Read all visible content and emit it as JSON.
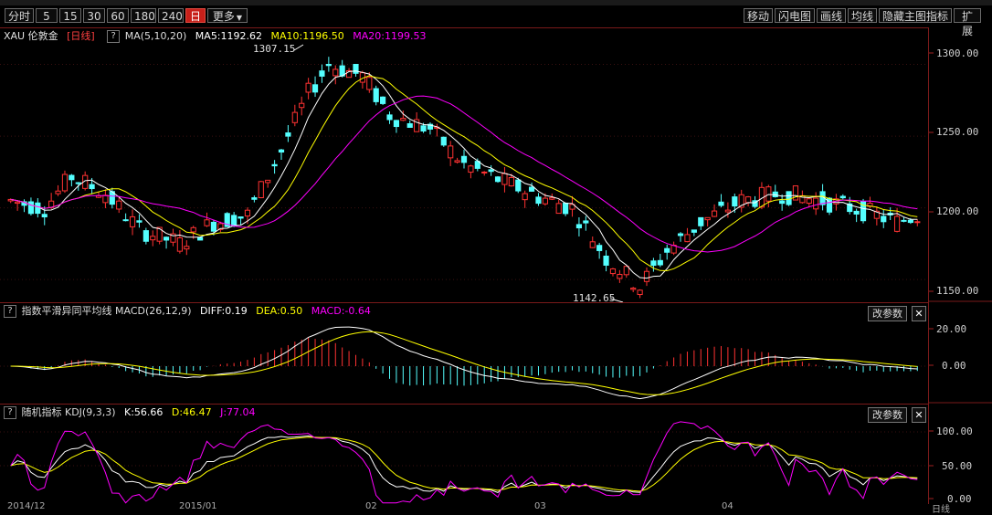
{
  "toolbar": {
    "left": [
      {
        "label": "分时",
        "active": false
      },
      {
        "label": "5",
        "active": false
      },
      {
        "label": "15",
        "active": false
      },
      {
        "label": "30",
        "active": false
      },
      {
        "label": "60",
        "active": false
      },
      {
        "label": "180",
        "active": false
      },
      {
        "label": "240",
        "active": false
      },
      {
        "label": "日",
        "active": true
      },
      {
        "label": "更多",
        "active": false,
        "dropdown": true
      }
    ],
    "right": [
      "移动",
      "闪电图",
      "画线",
      "均线",
      "隐藏主图指标",
      "扩展"
    ]
  },
  "price_panel": {
    "symbol": "XAU 伦敦金",
    "period": "[日线]",
    "help": "?",
    "ma_name": "MA(5,10,20)",
    "ma5": "MA5:1192.62",
    "ma10": "MA10:1196.50",
    "ma20": "MA20:1199.53",
    "high_label": "1307.15",
    "low_label": "1142.65",
    "axis": [
      "1300.00",
      "1250.00",
      "1200.00",
      "1150.00"
    ]
  },
  "macd_panel": {
    "help": "?",
    "name": "指数平滑异同平均线 MACD(26,12,9)",
    "diff": "DIFF:0.19",
    "dea": "DEA:0.50",
    "macd": "MACD:-0.64",
    "param_btn": "改参数",
    "close": "✕",
    "axis": [
      "20.00",
      "0.00"
    ]
  },
  "kdj_panel": {
    "help": "?",
    "name": "随机指标 KDJ(9,3,3)",
    "k": "K:56.66",
    "d": "D:46.47",
    "j": "J:77.04",
    "param_btn": "改参数",
    "close": "✕",
    "axis": [
      "100.00",
      "50.00",
      "0.00"
    ]
  },
  "dates": [
    "2014/12",
    "2015/01",
    "02",
    "03",
    "04"
  ],
  "corner_label": "日线",
  "colors": {
    "up": "#ff3232",
    "down": "#54ffff",
    "ma5": "#ffffff",
    "ma10": "#ffff00",
    "ma20": "#ff00ff",
    "j": "#ff00ff"
  },
  "chart_data": {
    "type": "candlestick",
    "price_axis": {
      "min": 1142.65,
      "max": 1307.15,
      "ticks": [
        1300,
        1250,
        1200,
        1150
      ]
    },
    "candles_count": 135
  }
}
